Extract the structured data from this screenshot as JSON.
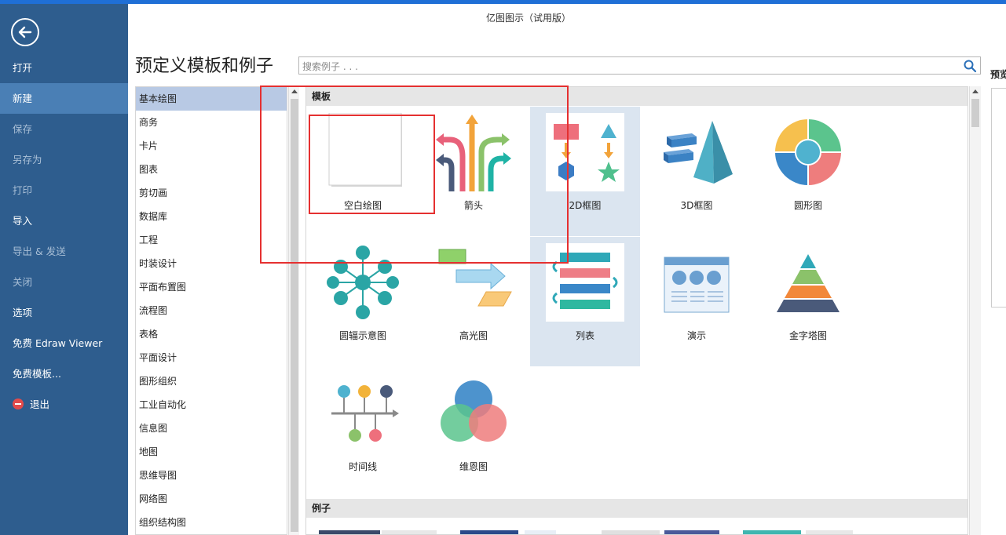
{
  "app": {
    "title": "亿图图示（试用版）"
  },
  "sidebar": {
    "items": [
      {
        "label": "打开",
        "state": "normal"
      },
      {
        "label": "新建",
        "state": "active"
      },
      {
        "label": "保存",
        "state": "disabled"
      },
      {
        "label": "另存为",
        "state": "disabled"
      },
      {
        "label": "打印",
        "state": "disabled"
      },
      {
        "label": "导入",
        "state": "normal"
      },
      {
        "label": "导出 & 发送",
        "state": "disabled"
      },
      {
        "label": "关闭",
        "state": "disabled"
      },
      {
        "label": "选项",
        "state": "normal"
      },
      {
        "label": "免费 Edraw Viewer",
        "state": "normal"
      },
      {
        "label": "免费模板...",
        "state": "normal"
      },
      {
        "label": "退出",
        "state": "normal"
      }
    ]
  },
  "page": {
    "title": "预定义模板和例子"
  },
  "search": {
    "placeholder": "搜索例子 . . ."
  },
  "preview": {
    "label": "预览"
  },
  "categories": [
    "基本绘图",
    "商务",
    "卡片",
    "图表",
    "剪切画",
    "数据库",
    "工程",
    "时装设计",
    "平面布置图",
    "流程图",
    "表格",
    "平面设计",
    "图形组织",
    "工业自动化",
    "信息图",
    "地图",
    "思维导图",
    "网络图",
    "组织结构图"
  ],
  "sections": {
    "templates": "模板",
    "examples": "例子"
  },
  "templates": [
    {
      "label": "空白绘图",
      "icon": "blank-page-icon"
    },
    {
      "label": "箭头",
      "icon": "arrows-icon"
    },
    {
      "label": "2D框图",
      "icon": "2d-block-icon"
    },
    {
      "label": "3D框图",
      "icon": "3d-block-icon"
    },
    {
      "label": "圆形图",
      "icon": "circular-chart-icon"
    },
    {
      "label": "圆辐示意图",
      "icon": "spoke-diagram-icon"
    },
    {
      "label": "高光图",
      "icon": "highlight-icon"
    },
    {
      "label": "列表",
      "icon": "list-icon"
    },
    {
      "label": "演示",
      "icon": "presentation-icon"
    },
    {
      "label": "金字塔图",
      "icon": "pyramid-icon"
    },
    {
      "label": "时间线",
      "icon": "timeline-icon"
    },
    {
      "label": "维恩图",
      "icon": "venn-icon"
    }
  ],
  "colors": {
    "sidebar": "#2e5d8e",
    "sidebar_active": "#4a7fb5",
    "annotation": "#e53030",
    "selected_category": "#b8c9e4"
  }
}
